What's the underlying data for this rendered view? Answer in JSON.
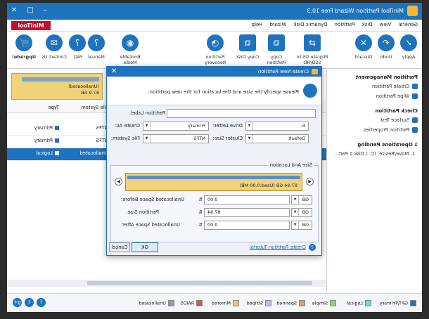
{
  "window": {
    "title": "MiniTool Partition Wizard Free 10.3",
    "brand": "MiniTool",
    "min": "–",
    "max": "□",
    "close": "✕"
  },
  "menu": [
    "General",
    "View",
    "Disk",
    "Partition",
    "Dynamic Disk",
    "Wizard",
    "Help"
  ],
  "toolbar": {
    "left": [
      {
        "label": "Apply",
        "icon": "check-icon",
        "glyph": "✓"
      },
      {
        "label": "Undo",
        "icon": "undo-icon",
        "glyph": "↶"
      },
      {
        "label": "Discard",
        "icon": "close-icon",
        "glyph": "✕"
      }
    ],
    "middle": [
      {
        "label": "Migrate OS to SSD/HD",
        "icon": "migrate-os-icon",
        "glyph": "⇄"
      },
      {
        "label": "Copy Partition",
        "icon": "copy-partition-icon",
        "glyph": "⧉"
      },
      {
        "label": "Copy Disk",
        "icon": "copy-disk-icon",
        "glyph": "⧉"
      },
      {
        "label": "Partition Recovery",
        "icon": "partition-recovery-icon",
        "glyph": "◔"
      }
    ],
    "right": [
      {
        "label": "Bootable Media",
        "icon": "bootable-media-icon",
        "glyph": "◉"
      },
      {
        "label": "Manual",
        "icon": "manual-icon",
        "glyph": "?"
      },
      {
        "label": "FAQ",
        "icon": "faq-icon",
        "glyph": "?"
      },
      {
        "label": "Contact Us",
        "icon": "contact-icon",
        "glyph": "✉"
      },
      {
        "label": "Upgrade!",
        "icon": "cart-icon",
        "glyph": "🛒"
      }
    ]
  },
  "sidebar": {
    "partition_management": "Partition Management",
    "items_pm": [
      "Create Partition",
      "Wipe Partition"
    ],
    "check_partition": "Check Partition",
    "items_cp": [
      "Surface Test",
      "Partition Properties"
    ],
    "pending": "1 Operations Pending",
    "pending_item": "1. Move/Resize: (C: ( Disk 1 Part..."
  },
  "disk": {
    "name": "(Unallocated)",
    "size": "87.9 GB"
  },
  "table": {
    "headers": [
      "File System",
      "Type"
    ],
    "rows": [
      {
        "fs": "NTFS",
        "type": "Primary",
        "selected": false
      },
      {
        "fs": "NTFS",
        "type": "Primary",
        "selected": false
      },
      {
        "fs": "Unallocated",
        "type": "Logical",
        "selected": true
      }
    ]
  },
  "legend": [
    "GPT/Primary",
    "Logical",
    "Simple",
    "Spanned",
    "Striped",
    "Mirrored",
    "RAID5",
    "Unallocated"
  ],
  "legend_colors": [
    "#1e73be",
    "#7fd3d8",
    "#9ccf71",
    "#c5a86a",
    "#c8b7e6",
    "#e2cf5c",
    "#e05050",
    "#9a9a9a"
  ],
  "social": [
    "f",
    "t",
    "g+"
  ],
  "dialog": {
    "title": "Create New Partition",
    "hint": "Please specify the size and the location for the new partition.",
    "partition_label": "Partition Label:",
    "partition_label_value": "",
    "create_as_label": "Create As:",
    "create_as_value": "Primary",
    "drive_letter_label": "Drive Letter:",
    "drive_letter_value": "E:",
    "file_system_label": "File System:",
    "file_system_value": "NTFS",
    "cluster_size_label": "Cluster Size:",
    "cluster_size_value": "Default",
    "size_location": "Size And Location",
    "bar_label": "87.94 GB (Used:0.00 MB)",
    "unalloc_before_label": "Unallocated Space Before:",
    "unalloc_before_value": "0.00",
    "partition_size_label": "Partition Size:",
    "partition_size_value": "87.94",
    "unalloc_after_label": "Unallocated Space After:",
    "unalloc_after_value": "0.00",
    "unit": "GB",
    "tutorial": "Create Partition Tutorial",
    "ok": "OK",
    "cancel": "Cancel"
  }
}
